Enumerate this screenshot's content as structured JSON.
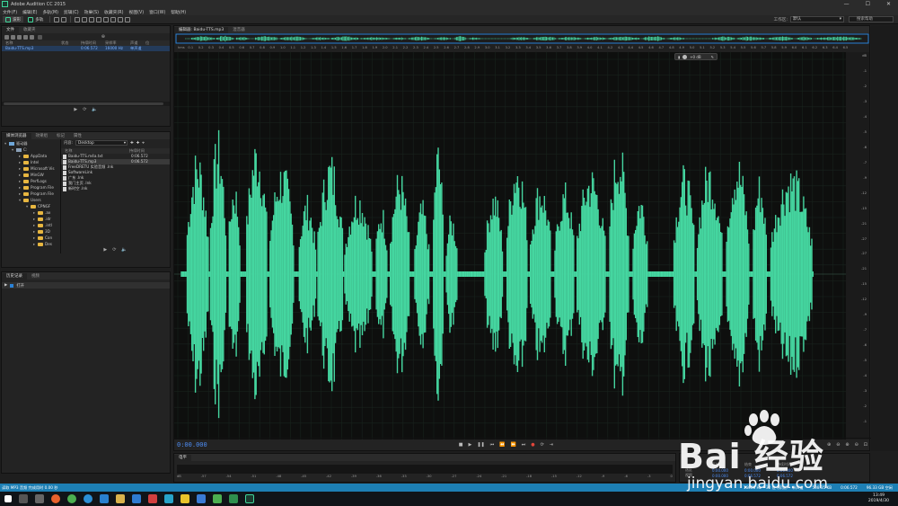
{
  "app": {
    "title": "Adobe Audition CC 2015"
  },
  "menu": [
    "文件(F)",
    "编辑(E)",
    "多轨(M)",
    "剪辑(C)",
    "效果(S)",
    "收藏夹(R)",
    "视图(V)",
    "窗口(W)",
    "帮助(H)"
  ],
  "toolbar": {
    "waveform_label": "波形",
    "multitrack_label": "多轨",
    "workspace_label": "工作区:",
    "workspace_value": "默认",
    "help_search_label": "搜索帮助"
  },
  "files_panel": {
    "tabs": [
      "文件",
      "收藏夹"
    ],
    "columns": {
      "name": "名称",
      "status": "状态",
      "duration": "持续时间",
      "sample_rate": "采样率",
      "channels": "声道",
      "bits": "位"
    },
    "files": [
      {
        "name": "Baidu-TTS.mp3",
        "duration": "0:06.572",
        "sample_rate": "16000 Hz",
        "channels": "单声道"
      }
    ]
  },
  "browser_panel": {
    "tabs": [
      "媒体浏览器",
      "效果组",
      "标记",
      "属性"
    ],
    "content_label": "内容:",
    "content_value": "Desktop",
    "tree": [
      {
        "label": "驱动器",
        "level": 0,
        "kind": "pc",
        "open": true
      },
      {
        "label": "C:",
        "level": 1,
        "kind": "drive",
        "open": true
      },
      {
        "label": "AppData",
        "level": 2,
        "kind": "folder"
      },
      {
        "label": "Intel",
        "level": 2,
        "kind": "folder"
      },
      {
        "label": "Microsoft Vis",
        "level": 2,
        "kind": "folder"
      },
      {
        "label": "MinGW",
        "level": 2,
        "kind": "folder"
      },
      {
        "label": "PerfLogs",
        "level": 2,
        "kind": "folder"
      },
      {
        "label": "Program File",
        "level": 2,
        "kind": "folder"
      },
      {
        "label": "Program File",
        "level": 2,
        "kind": "folder"
      },
      {
        "label": "Users",
        "level": 2,
        "kind": "folder",
        "open": true
      },
      {
        "label": "CPNGF",
        "level": 3,
        "kind": "folder",
        "open": true
      },
      {
        "label": ".ax",
        "level": 4,
        "kind": "folder"
      },
      {
        "label": ".idr",
        "level": 4,
        "kind": "folder"
      },
      {
        "label": ".intl",
        "level": 4,
        "kind": "folder"
      },
      {
        "label": "3D",
        "level": 4,
        "kind": "folder"
      },
      {
        "label": "Con",
        "level": 4,
        "kind": "folder"
      },
      {
        "label": "Des",
        "level": 4,
        "kind": "folder"
      }
    ],
    "list_columns": {
      "name": "名称",
      "duration": "持续时间"
    },
    "list": [
      {
        "name": "Baidu-TTS.m4a.txt",
        "duration": "0:06.572"
      },
      {
        "name": "Baidu-TTS.mp3",
        "duration": "0:06.572",
        "selected": true
      },
      {
        "name": "FreeDRETU 实验音频 .lnk",
        "duration": ""
      },
      {
        "name": "SoftwareLink",
        "duration": ""
      },
      {
        "name": "广东 .lnk",
        "duration": ""
      },
      {
        "name": "我门主页 .lnk",
        "duration": ""
      },
      {
        "name": "新时空 .lnk",
        "duration": ""
      }
    ]
  },
  "history_panel": {
    "tabs": [
      "历史记录",
      "视频"
    ],
    "item": "打开"
  },
  "editor": {
    "tabs": [
      "编辑器: Baidu-TTS.mp3",
      "混音器"
    ],
    "hud_value": "+0 dB",
    "time": "0:00.000",
    "ruler_ticks": [
      "hms",
      "0.1",
      "0.2",
      "0.3",
      "0.4",
      "0.5",
      "0.6",
      "0.7",
      "0.8",
      "0.9",
      "1.0",
      "1.1",
      "1.2",
      "1.3",
      "1.4",
      "1.5",
      "1.6",
      "1.7",
      "1.8",
      "1.9",
      "2.0",
      "2.1",
      "2.2",
      "2.3",
      "2.4",
      "2.5",
      "2.6",
      "2.7",
      "2.8",
      "2.9",
      "3.0",
      "3.1",
      "3.2",
      "3.3",
      "3.4",
      "3.5",
      "3.6",
      "3.7",
      "3.8",
      "3.9",
      "4.0",
      "4.1",
      "4.2",
      "4.3",
      "4.4",
      "4.5",
      "4.6",
      "4.7",
      "4.8",
      "4.9",
      "5.0",
      "5.1",
      "5.2",
      "5.3",
      "5.4",
      "5.5",
      "5.6",
      "5.7",
      "5.8",
      "5.9",
      "6.0",
      "6.1",
      "6.2",
      "6.3",
      "6.4",
      "6.5"
    ],
    "db_scale": [
      "dB",
      "-1",
      "-2",
      "-3",
      "-4",
      "-5",
      "-6",
      "-7",
      "-9",
      "-12",
      "-15",
      "-21",
      "-27",
      "-27",
      "-21",
      "-15",
      "-12",
      "-9",
      "-7",
      "-6",
      "-5",
      "-4",
      "-3",
      "-2",
      "-1"
    ]
  },
  "levels": {
    "label": "电平",
    "scale": [
      "dB",
      "-57",
      "-54",
      "-51",
      "-48",
      "-45",
      "-42",
      "-39",
      "-36",
      "-33",
      "-30",
      "-27",
      "-24",
      "-21",
      "-18",
      "-15",
      "-12",
      "-9",
      "-6",
      "-3",
      "0"
    ]
  },
  "selection": {
    "headers": [
      "开始",
      "结束",
      "持续时间"
    ],
    "rows": [
      {
        "label": "选区",
        "start": "0:00.000",
        "end": "0:00.000",
        "dur": "0:00.000"
      },
      {
        "label": "视图",
        "start": "0:00.000",
        "end": "0:06.572",
        "dur": "0:06.572"
      }
    ]
  },
  "status": {
    "left": "读取 MP3 音频 完成用时 0.00 秒",
    "right_items": [
      "16000 Hz • 32 位 (浮点) • 单声道",
      "508.35 KB",
      "0:06.572",
      "96.33 GB 空闲"
    ]
  },
  "taskbar": {
    "time": "13:49",
    "date": "2019/4/30"
  },
  "colors": {
    "waveform": "#45d6a0",
    "accent_blue": "#1d7fb4",
    "time": "#4d8cf2"
  },
  "watermark": {
    "brand": "Bai 经验",
    "url": "jingyan.baidu.com"
  }
}
